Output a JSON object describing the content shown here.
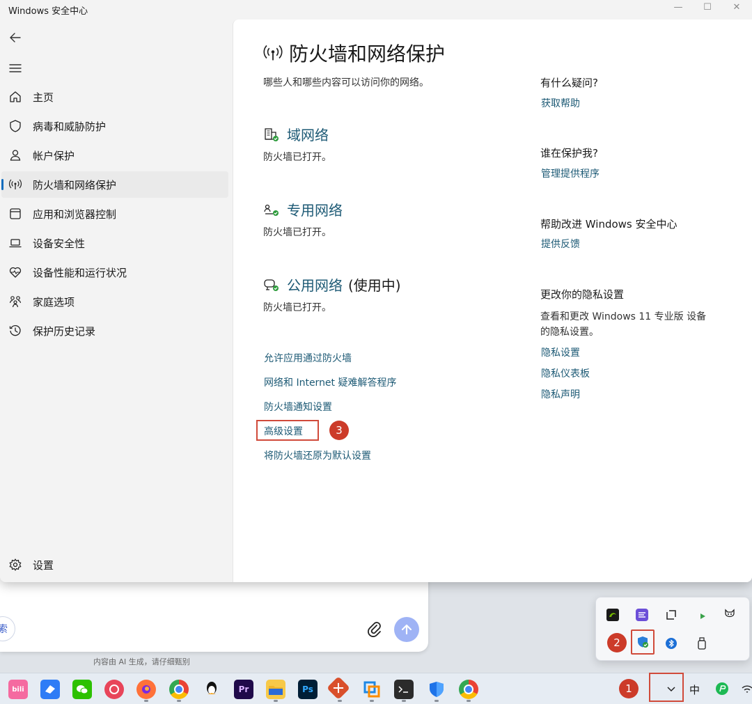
{
  "window": {
    "title": "Windows 安全中心",
    "controls": {
      "minimize": "—",
      "maximize": "☐",
      "close": "✕"
    }
  },
  "sidebar": {
    "items": [
      {
        "label": "主页",
        "icon": "home-icon",
        "active": false
      },
      {
        "label": "病毒和威胁防护",
        "icon": "shield-icon",
        "active": false
      },
      {
        "label": "帐户保护",
        "icon": "person-icon",
        "active": false
      },
      {
        "label": "防火墙和网络保护",
        "icon": "antenna-icon",
        "active": true
      },
      {
        "label": "应用和浏览器控制",
        "icon": "app-window-icon",
        "active": false
      },
      {
        "label": "设备安全性",
        "icon": "laptop-icon",
        "active": false
      },
      {
        "label": "设备性能和运行状况",
        "icon": "heart-pulse-icon",
        "active": false
      },
      {
        "label": "家庭选项",
        "icon": "family-icon",
        "active": false
      },
      {
        "label": "保护历史记录",
        "icon": "history-icon",
        "active": false
      }
    ],
    "settings_label": "设置"
  },
  "main": {
    "title": "防火墙和网络保护",
    "subtitle": "哪些人和哪些内容可以访问你的网络。",
    "networks": [
      {
        "name": "域网络",
        "in_use": "",
        "status": "防火墙已打开。",
        "icon": "domain-network-icon"
      },
      {
        "name": "专用网络",
        "in_use": "",
        "status": "防火墙已打开。",
        "icon": "private-network-icon"
      },
      {
        "name": "公用网络",
        "in_use": "(使用中)",
        "status": "防火墙已打开。",
        "icon": "public-network-icon"
      }
    ],
    "links": [
      "允许应用通过防火墙",
      "网络和 Internet 疑难解答程序",
      "防火墙通知设置",
      "高级设置",
      "将防火墙还原为默认设置"
    ],
    "highlight_badge": "3"
  },
  "aside": {
    "sections": [
      {
        "heading": "有什么疑问?",
        "desc": "",
        "links": [
          "获取帮助"
        ]
      },
      {
        "heading": "谁在保护我?",
        "desc": "",
        "links": [
          "管理提供程序"
        ]
      },
      {
        "heading": "帮助改进 Windows 安全中心",
        "desc": "",
        "links": [
          "提供反馈"
        ]
      },
      {
        "heading": "更改你的隐私设置",
        "desc": "查看和更改 Windows 11 专业版 设备的隐私设置。",
        "links": [
          "隐私设置",
          "隐私仪表板",
          "隐私声明"
        ]
      }
    ]
  },
  "chat": {
    "pill_text": "索",
    "ai_note": "内容由 AI 生成，请仔细甄别"
  },
  "tray": {
    "badge": "2",
    "icons": [
      "nvidia-icon",
      "app-purple-icon",
      "crop-icon",
      "play-icon",
      "cat-icon",
      "security-shield-icon",
      "bluetooth-icon",
      "usb-drive-icon"
    ]
  },
  "taskbar": {
    "badge": "1",
    "ime": "中",
    "apps": [
      "bilibili-icon",
      "feishu-icon",
      "wechat-icon",
      "netease-music-icon",
      "firefox-icon",
      "chrome-icon",
      "qq-icon",
      "premiere-icon",
      "folder-icon",
      "photoshop-icon",
      "remote-desktop-icon",
      "vm-icon",
      "terminal-icon",
      "defender-icon",
      "chrome-icon"
    ],
    "app_labels": {
      "bilibili": "bili",
      "premiere": "Pr",
      "photoshop": "Ps"
    }
  }
}
